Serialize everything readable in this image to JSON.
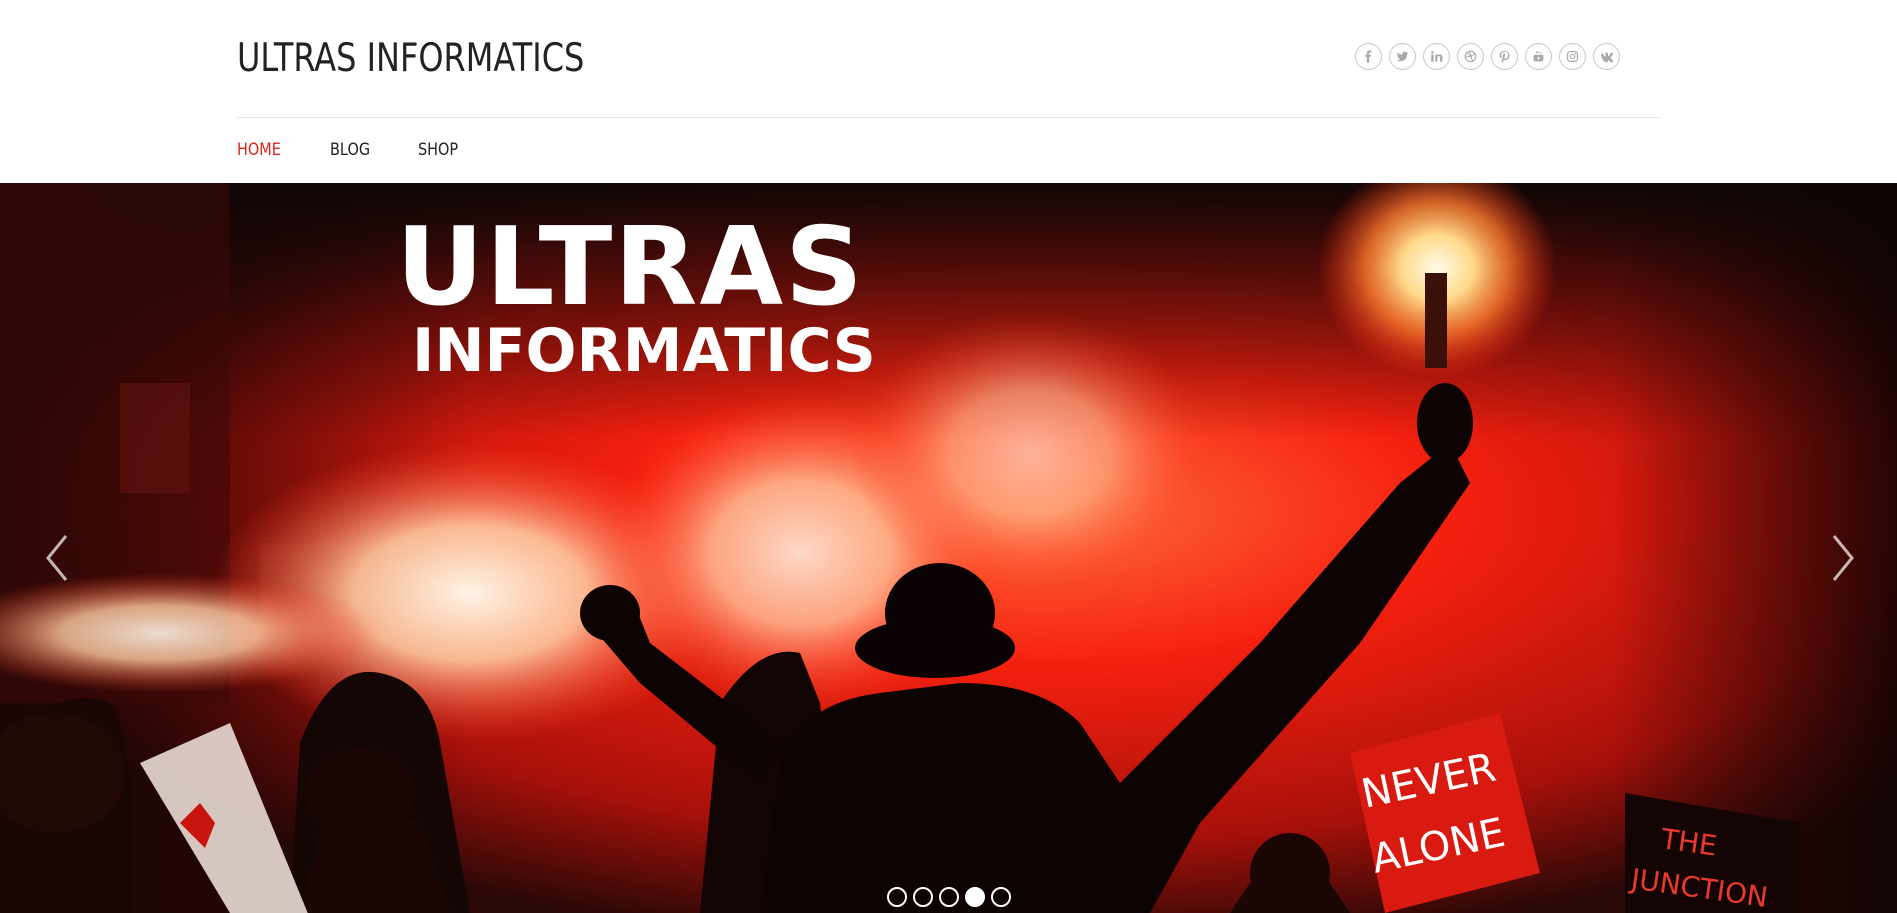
{
  "site": {
    "title": "ULTRAS INFORMATICS"
  },
  "social": [
    {
      "name": "facebook-icon",
      "glyph": "f"
    },
    {
      "name": "twitter-icon",
      "glyph": "t"
    },
    {
      "name": "linkedin-icon",
      "glyph": "in"
    },
    {
      "name": "dribbble-icon",
      "glyph": "◎"
    },
    {
      "name": "pinterest-icon",
      "glyph": "p"
    },
    {
      "name": "youtube-icon",
      "glyph": "▶"
    },
    {
      "name": "instagram-icon",
      "glyph": "◻"
    },
    {
      "name": "vk-icon",
      "glyph": "vk"
    }
  ],
  "nav": {
    "items": [
      {
        "label": "HOME",
        "active": true
      },
      {
        "label": "BLOG",
        "active": false
      },
      {
        "label": "SHOP",
        "active": false
      }
    ]
  },
  "hero": {
    "title_line1": "ULTRAS",
    "title_line2": "INFORMATICS",
    "sign_text1": "NEVER",
    "sign_text2": "ALONE",
    "sign_text3": "THE",
    "sign_text4": "JUNCTION",
    "slider_total": 5,
    "slider_active": 4
  },
  "colors": {
    "accent": "#d9251c",
    "text": "#222222",
    "hero_red": "#e0140c"
  }
}
